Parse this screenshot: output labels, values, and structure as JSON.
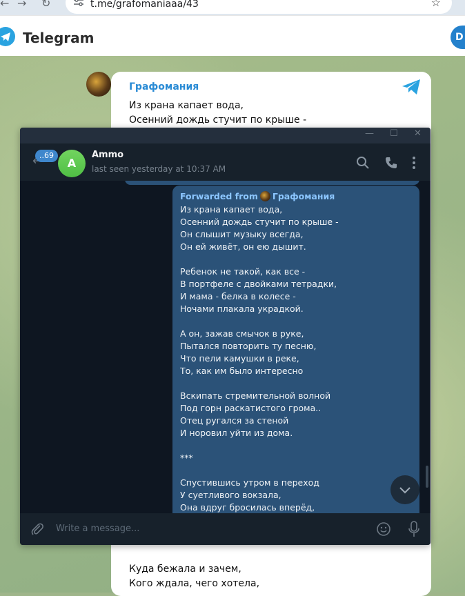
{
  "browser": {
    "url": "t.me/grafomaniaaa/43"
  },
  "tg_web": {
    "title": "Telegram",
    "open_button": "D"
  },
  "channel_post": {
    "name": "Графомания",
    "lines_top": [
      "Из крана капает вода,",
      "Осенний дождь стучит по крыше -"
    ],
    "lines_bottom": [
      "Куда бежала и зачем,",
      "Кого ждала, чего хотела,"
    ]
  },
  "window": {
    "unread_count": "..69",
    "contact_name": "Ammo",
    "contact_initial": "A",
    "status": "last seen yesterday at 10:37 AM",
    "forwarded_label": "Forwarded from",
    "forwarded_source": "Графомания",
    "message_lines": [
      "Из крана капает вода,",
      "Осенний дождь стучит по крыше -",
      "Он слышит музыку всегда,",
      "Он ей живёт, он ею дышит.",
      "",
      "Ребенок не такой, как все -",
      "В портфеле с двойками тетрадки,",
      "И мама - белка в колесе -",
      "Ночами плакала украдкой.",
      "",
      "А он, зажав смычок в руке,",
      "Пытался повторить ту песню,",
      "Что пели камушки в реке,",
      "То, как им было интересно",
      "",
      "Вскипать стремительной волной",
      "Под горн раскатистого грома..",
      "Отец ругался за стеной",
      "И норовил уйти из дома.",
      "",
      "***",
      "",
      "Спустившись утром в переход",
      "У суетливого вокзала,",
      "Она вдруг бросилась вперёд,"
    ],
    "composer_placeholder": "Write a message..."
  },
  "colors": {
    "accent": "#2aa3e0",
    "bubble": "#2b5278",
    "window_bg": "#17212b",
    "chat_bg": "#0e1621",
    "link": "#8cc6ff"
  }
}
